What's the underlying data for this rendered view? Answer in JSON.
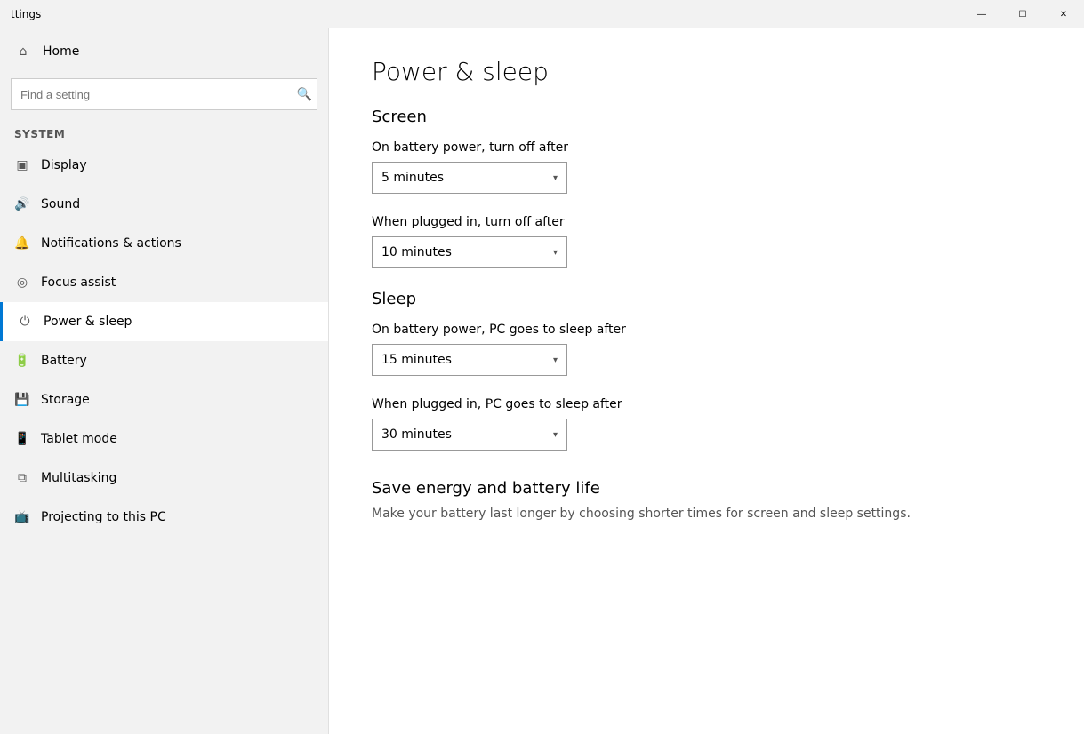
{
  "titleBar": {
    "title": "ttings",
    "minimizeLabel": "—",
    "maximizeLabel": "☐",
    "closeLabel": "✕"
  },
  "sidebar": {
    "homeLabel": "Home",
    "searchPlaceholder": "Find a setting",
    "systemLabel": "System",
    "navItems": [
      {
        "id": "display",
        "label": "Display",
        "icon": "display"
      },
      {
        "id": "sound",
        "label": "Sound",
        "icon": "sound"
      },
      {
        "id": "notifications",
        "label": "Notifications & actions",
        "icon": "notifications"
      },
      {
        "id": "focus-assist",
        "label": "Focus assist",
        "icon": "focus"
      },
      {
        "id": "power-sleep",
        "label": "Power & sleep",
        "icon": "power",
        "active": true
      },
      {
        "id": "battery",
        "label": "Battery",
        "icon": "battery"
      },
      {
        "id": "storage",
        "label": "Storage",
        "icon": "storage"
      },
      {
        "id": "tablet-mode",
        "label": "Tablet mode",
        "icon": "tablet"
      },
      {
        "id": "multitasking",
        "label": "Multitasking",
        "icon": "multitasking"
      },
      {
        "id": "projecting",
        "label": "Projecting to this PC",
        "icon": "projecting"
      }
    ]
  },
  "main": {
    "pageTitle": "Power & sleep",
    "screenSection": {
      "title": "Screen",
      "batteryLabel": "On battery power, turn off after",
      "batteryValue": "5 minutes",
      "pluggedLabel": "When plugged in, turn off after",
      "pluggedValue": "10 minutes"
    },
    "sleepSection": {
      "title": "Sleep",
      "batteryLabel": "On battery power, PC goes to sleep after",
      "batteryValue": "15 minutes",
      "pluggedLabel": "When plugged in, PC goes to sleep after",
      "pluggedValue": "30 minutes"
    },
    "saveEnergy": {
      "title": "Save energy and battery life",
      "description": "Make your battery last longer by choosing shorter times for screen and sleep settings."
    }
  }
}
